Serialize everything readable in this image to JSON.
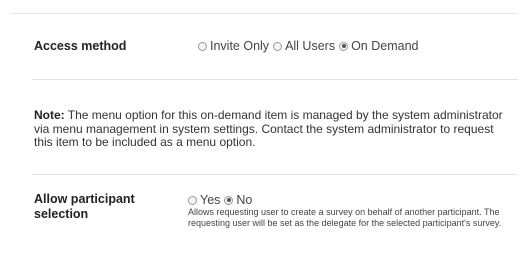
{
  "access_method": {
    "label": "Access method",
    "options": [
      {
        "label": "Invite Only",
        "checked": false
      },
      {
        "label": "All Users",
        "checked": false
      },
      {
        "label": "On Demand",
        "checked": true
      }
    ]
  },
  "note": {
    "prefix": "Note:",
    "text": " The menu option for this on-demand item is managed by the system administrator via menu management in system settings. Contact the system administrator to request this item to be included as a menu option."
  },
  "allow_participant_selection": {
    "label": "Allow participant selection",
    "options": [
      {
        "label": "Yes",
        "checked": false
      },
      {
        "label": "No",
        "checked": true
      }
    ],
    "help": "Allows requesting user to create a survey on behalf of another participant. The requesting user will be set as the delegate for the selected participant's survey."
  }
}
